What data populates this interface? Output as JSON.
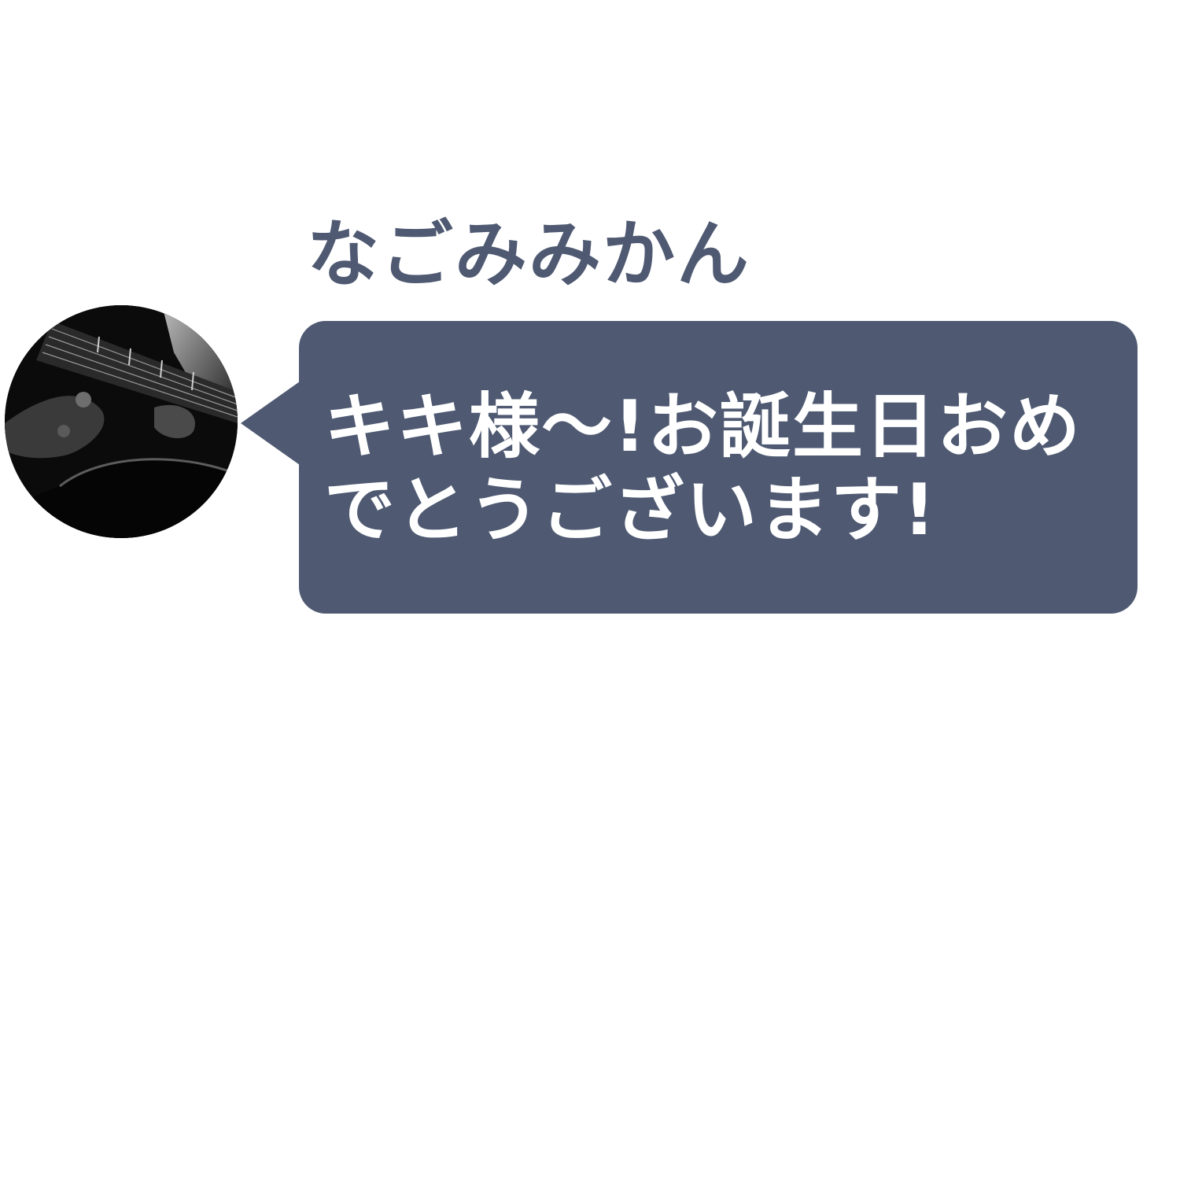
{
  "colors": {
    "bubble": "#4f5a72",
    "sender_name": "#4f5a72",
    "message_text": "#ffffff",
    "background": "#ffffff"
  },
  "message": {
    "sender": "なごみみかん",
    "avatar_icon": "guitar-photo-avatar",
    "text": "キキ様〜!お誕生日おめでとうございます!"
  }
}
